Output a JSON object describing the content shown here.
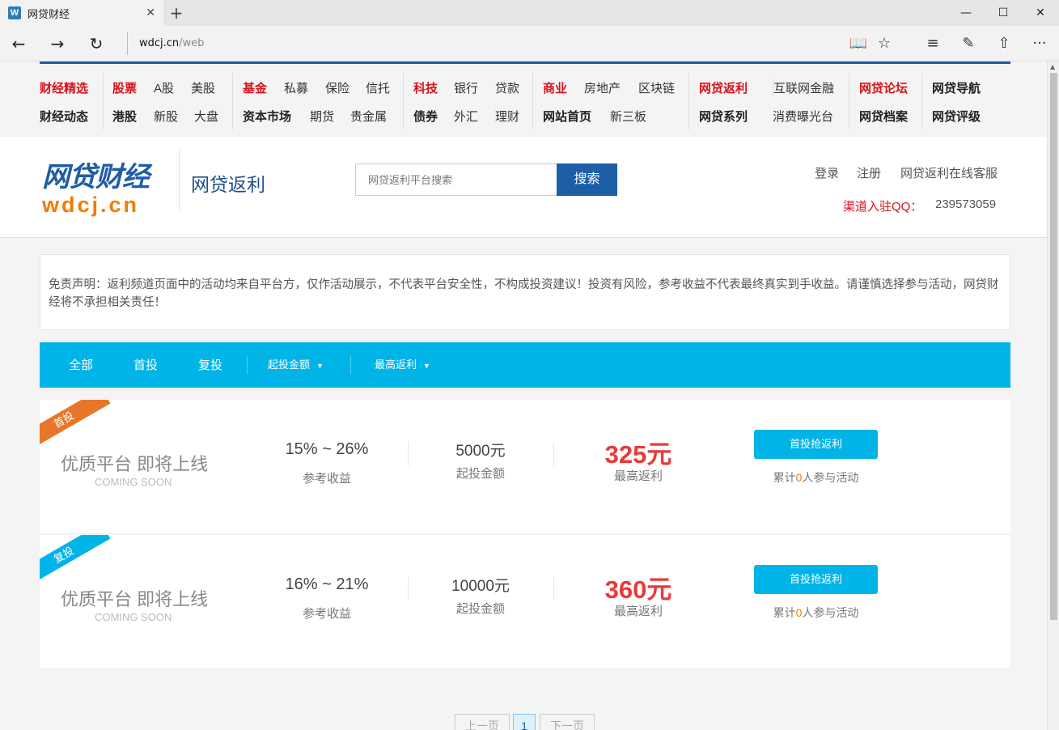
{
  "browser": {
    "tab_title": "网贷财经",
    "tab_favicon": "W",
    "close_glyph": "✕",
    "new_tab_glyph": "+",
    "window": {
      "minimize": "—",
      "maximize": "☐",
      "close": "✕"
    },
    "url_host": "wdcj.cn",
    "url_path": "/web",
    "nav": {
      "back": "←",
      "forward": "→",
      "refresh": "↻"
    },
    "tools": {
      "reading": "📖",
      "favorite": "☆",
      "hub": "≡",
      "note": "✎",
      "share": "⇧",
      "more": "···"
    }
  },
  "top_nav": {
    "groups": [
      {
        "row1": [
          {
            "label": "财经精选",
            "style": "red"
          },
          {
            "label": "股票",
            "style": "red"
          },
          {
            "label": "A股",
            "style": "normal"
          },
          {
            "label": "美股",
            "style": "normal"
          }
        ],
        "row2": [
          {
            "label": "财经动态",
            "style": "bold"
          },
          {
            "label": "港股",
            "style": "bold"
          },
          {
            "label": "新股",
            "style": "normal"
          },
          {
            "label": "大盘",
            "style": "normal"
          }
        ]
      }
    ],
    "items": [
      {
        "label": "财经精选",
        "style": "red"
      },
      {
        "label": "财经动态",
        "style": "bold"
      },
      {
        "label": "股票",
        "style": "red"
      },
      {
        "label": "港股",
        "style": "bold"
      },
      {
        "label": "A股",
        "style": "normal"
      },
      {
        "label": "新股",
        "style": "normal"
      },
      {
        "label": "美股",
        "style": "normal"
      },
      {
        "label": "大盘",
        "style": "normal"
      },
      {
        "label": "基金",
        "style": "red"
      },
      {
        "label": "资本市场",
        "style": "bold"
      },
      {
        "label": "私募",
        "style": "normal"
      },
      {
        "label": "期货",
        "style": "normal"
      },
      {
        "label": "保险",
        "style": "normal"
      },
      {
        "label": "贵金属",
        "style": "normal"
      },
      {
        "label": "信托",
        "style": "normal"
      },
      {
        "label": "科技",
        "style": "red"
      },
      {
        "label": "债券",
        "style": "bold"
      },
      {
        "label": "银行",
        "style": "normal"
      },
      {
        "label": "外汇",
        "style": "normal"
      },
      {
        "label": "贷款",
        "style": "normal"
      },
      {
        "label": "理财",
        "style": "normal"
      },
      {
        "label": "商业",
        "style": "red"
      },
      {
        "label": "网站首页",
        "style": "bold"
      },
      {
        "label": "房地产",
        "style": "normal"
      },
      {
        "label": "新三板",
        "style": "normal"
      },
      {
        "label": "区块链",
        "style": "normal"
      },
      {
        "label": "网贷返利",
        "style": "red"
      },
      {
        "label": "网贷系列",
        "style": "bold"
      },
      {
        "label": "互联网金融",
        "style": "normal"
      },
      {
        "label": "消费曝光台",
        "style": "normal"
      },
      {
        "label": "网贷论坛",
        "style": "red"
      },
      {
        "label": "网贷档案",
        "style": "bold"
      },
      {
        "label": "网贷导航",
        "style": "bold"
      },
      {
        "label": "网贷评级",
        "style": "bold"
      }
    ]
  },
  "header": {
    "logo_top": "网贷财经",
    "logo_bottom": "wdcj.cn",
    "section_title": "网贷返利",
    "search_placeholder": "网贷返利平台搜索",
    "search_button": "搜索",
    "login": "登录",
    "register": "注册",
    "service": "网贷返利在线客服",
    "qq_label": "渠道入驻QQ：",
    "qq_number": "239573059"
  },
  "notice": "免责声明：返利频道页面中的活动均来自平台方，仅作活动展示，不代表平台安全性，不构成投资建议！投资有风险，参考收益不代表最终真实到手收益。请谨慎选择参与活动，网贷财经将不承担相关责任！",
  "filters": {
    "all": "全部",
    "first": "首投",
    "repeat": "复投",
    "min_amount": "起投金额",
    "max_rebate": "最高返利",
    "caret": "▼"
  },
  "cards": [
    {
      "ribbon": "首投",
      "name": "优质平台 即将上线",
      "sub": "COMING SOON",
      "yield": "15% ~ 26%",
      "yield_label": "参考收益",
      "amount": "5000元",
      "amount_label": "起投金额",
      "rebate": "325元",
      "rebate_label": "最高返利",
      "button": "首投抢返利",
      "part_prefix": "累计",
      "part_count": "0",
      "part_suffix": "人参与活动"
    },
    {
      "ribbon": "复投",
      "name": "优质平台 即将上线",
      "sub": "COMING SOON",
      "yield": "16% ~ 21%",
      "yield_label": "参考收益",
      "amount": "10000元",
      "amount_label": "起投金额",
      "rebate": "360元",
      "rebate_label": "最高返利",
      "button": "首投抢返利",
      "part_prefix": "累计",
      "part_count": "0",
      "part_suffix": "人参与活动"
    }
  ],
  "pager": {
    "prev": "上一页",
    "current": "1",
    "next": "下一页"
  },
  "colors": {
    "brand_blue": "#1f5da6",
    "accent_cyan": "#00b4e8",
    "red": "#d7121b",
    "orange": "#ef7d00"
  }
}
